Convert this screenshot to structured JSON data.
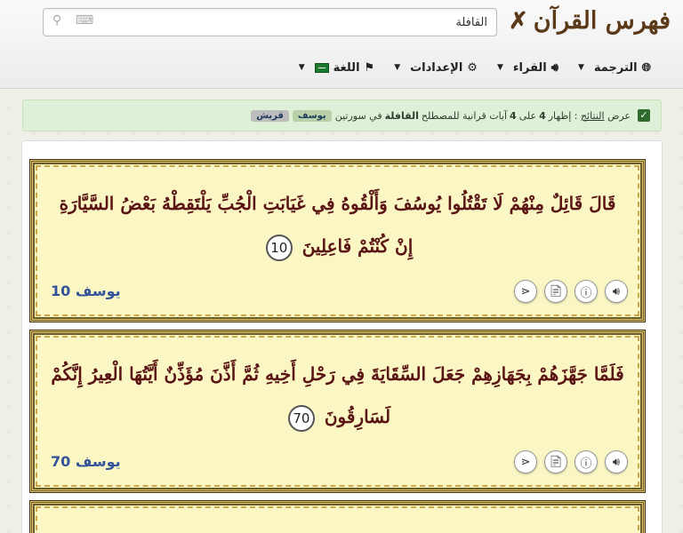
{
  "app": {
    "title": "فهرس القرآن"
  },
  "search": {
    "value": "القافلة",
    "placeholder": ""
  },
  "menu": {
    "translation": "الترجمة",
    "reciters": "القراء",
    "settings": "الإعدادات",
    "language": "اللغة"
  },
  "alert": {
    "prefix": "عرض",
    "results_link": "النتائج",
    "colon": ":",
    "showing": "إظهار",
    "shown_count": "4",
    "of": "على",
    "total_count": "4",
    "verses_for_term": "آيات قرانية للمصطلح",
    "term": "القافلة",
    "in_surahs": "في سورتين",
    "surah_tags": [
      "يوسف",
      "قريش"
    ]
  },
  "ayat": [
    {
      "text": "قَالَ قَائِلٌ مِنْهُمْ لَا تَقْتُلُوا يُوسُفَ وَأَلْقُوهُ فِي غَيَابَتِ الْجُبِّ يَلْتَقِطْهُ بَعْضُ السَّيَّارَةِ إِنْ كُنْتُمْ فَاعِلِينَ",
      "number": "10",
      "reference": "يوسف 10"
    },
    {
      "text": "فَلَمَّا جَهَّزَهُمْ بِجَهَازِهِمْ جَعَلَ السِّقَايَةَ فِي رَحْلِ أَخِيهِ ثُمَّ أَذَّنَ مُؤَذِّنٌ أَيَّتُهَا الْعِيرُ إِنَّكُمْ لَسَارِقُونَ",
      "number": "70",
      "reference": "يوسف 70"
    }
  ],
  "icons": {
    "brand": "quill-icon",
    "search": "search-icon",
    "keyboard": "keyboard-icon",
    "globe": "globe-icon",
    "speaker": "speaker-icon",
    "gear": "gear-icon",
    "flag": "flag-icon",
    "audio": "audio-icon",
    "info": "info-icon",
    "pdf": "pdf-icon",
    "share": "share-icon"
  },
  "colors": {
    "brand": "#5b3a1a",
    "ayah_text": "#5a1414",
    "reference": "#34539a",
    "ayah_bg": "#fbf7c4",
    "alert_bg": "#dff0d8"
  }
}
